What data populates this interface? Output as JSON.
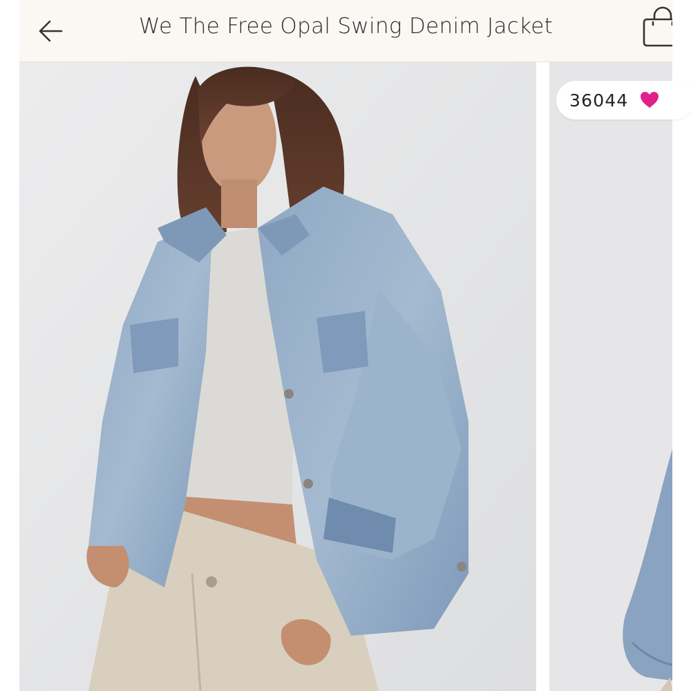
{
  "header": {
    "title": "We The Free Opal Swing Denim Jacket",
    "back_icon": "arrow-left-icon",
    "bag_icon": "shopping-bag-icon",
    "background": "#fbf7f3"
  },
  "gallery": {
    "likes_count": "36044",
    "likes_icon": "heart-icon",
    "heart_color": "#e0218a"
  }
}
